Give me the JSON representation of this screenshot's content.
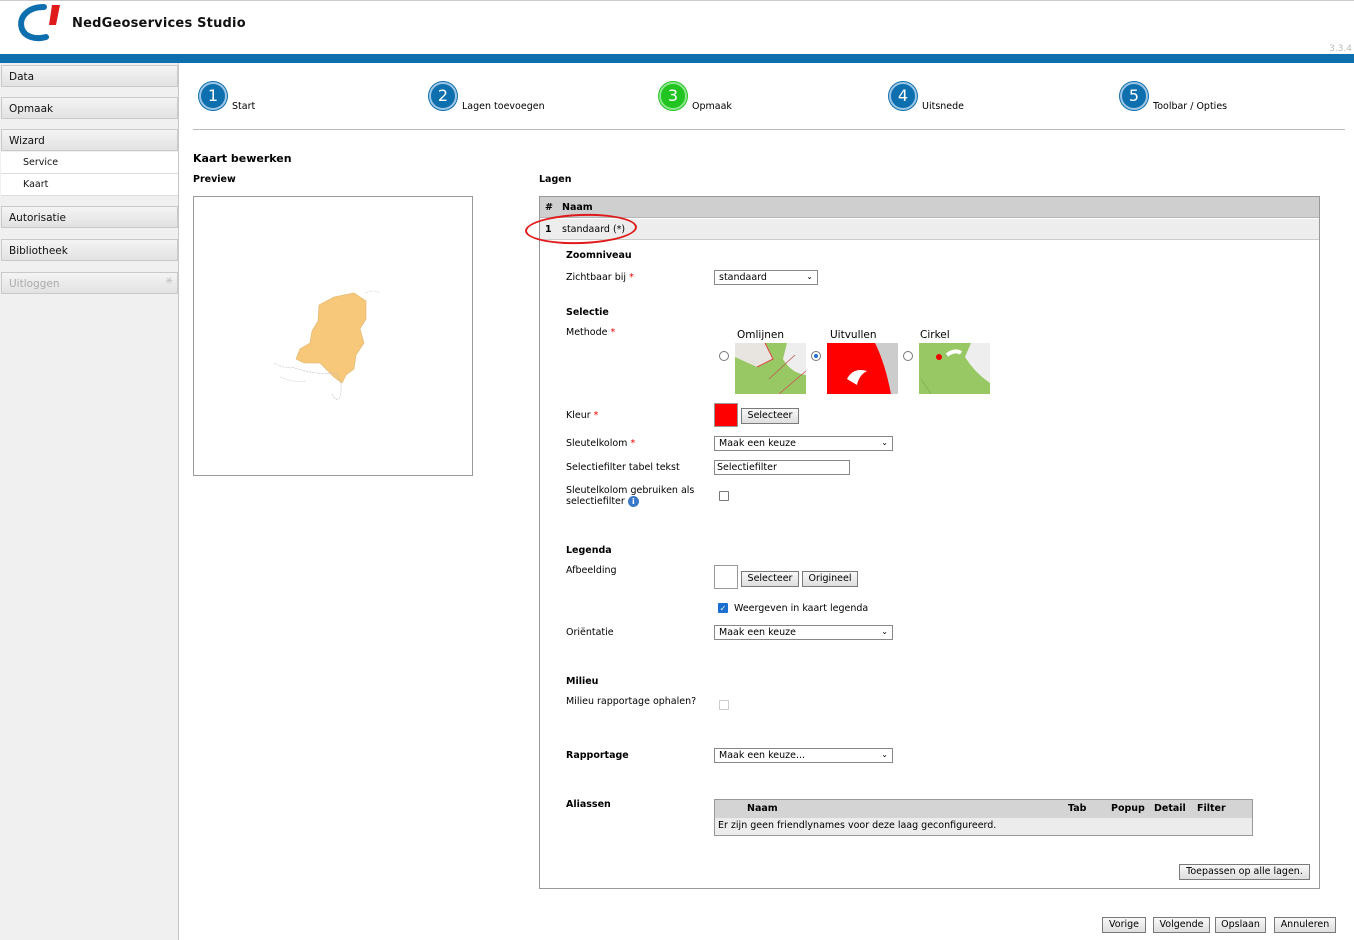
{
  "app": {
    "title": "NedGeoservices Studio",
    "version": "3.3.4"
  },
  "sidebar": {
    "items": [
      {
        "label": "Data"
      },
      {
        "label": "Opmaak"
      },
      {
        "label": "Wizard"
      },
      {
        "label": "Autorisatie"
      },
      {
        "label": "Bibliotheek"
      },
      {
        "label": "Uitloggen"
      }
    ],
    "wizard_sub": [
      {
        "label": "Service"
      },
      {
        "label": "Kaart"
      }
    ]
  },
  "wizard": {
    "steps": [
      {
        "num": "1",
        "label": "Start"
      },
      {
        "num": "2",
        "label": "Lagen toevoegen"
      },
      {
        "num": "3",
        "label": "Opmaak",
        "active": true
      },
      {
        "num": "4",
        "label": "Uitsnede"
      },
      {
        "num": "5",
        "label": "Toolbar / Opties"
      }
    ]
  },
  "page": {
    "title": "Kaart bewerken",
    "preview_label": "Preview",
    "lagen_label": "Lagen"
  },
  "lagen": {
    "col_num": "#",
    "col_name": "Naam",
    "row": {
      "num": "1",
      "name": "standaard (*)"
    }
  },
  "form": {
    "zoom": {
      "heading": "Zoomniveau",
      "label": "Zichtbaar bij",
      "required": "*",
      "value": "standaard"
    },
    "selectie": {
      "heading": "Selectie",
      "method_label": "Methode",
      "required": "*",
      "options": [
        "Omlijnen",
        "Uitvullen",
        "Cirkel"
      ],
      "selected_option": "Uitvullen",
      "kleur_label": "Kleur",
      "kleur_color": "#ff0000",
      "kleur_button": "Selecteer",
      "sleutel_label": "Sleutelkolom",
      "sleutel_value": "Maak een keuze",
      "filter_label": "Selectiefilter tabel tekst",
      "filter_value": "Selectiefilter",
      "use_as_filter_label_1": "Sleutelkolom gebruiken als",
      "use_as_filter_label_2": "selectiefilter",
      "use_as_filter_checked": false
    },
    "legenda": {
      "heading": "Legenda",
      "afbeelding_label": "Afbeelding",
      "select_button": "Selecteer",
      "original_button": "Origineel",
      "show_label": "Weergeven in kaart legenda",
      "show_checked": true,
      "orientatie_label": "Oriëntatie",
      "orientatie_value": "Maak een keuze"
    },
    "milieu": {
      "heading": "Milieu",
      "label": "Milieu rapportage ophalen?",
      "checked": false
    },
    "rapportage": {
      "heading": "Rapportage",
      "value": "Maak een keuze..."
    },
    "aliassen": {
      "heading": "Aliassen",
      "columns": [
        "Naam",
        "Tab",
        "Popup",
        "Detail",
        "Filter"
      ],
      "empty_text": "Er zijn geen friendlynames voor deze laag geconfigureerd."
    },
    "apply_all_button": "Toepassen op alle lagen."
  },
  "footer": {
    "prev": "Vorige",
    "next": "Volgende",
    "save": "Opslaan",
    "cancel": "Annuleren"
  },
  "colors": {
    "brand_blue": "#0e6fae",
    "step_active": "#22c422",
    "map_fill": "#f7c77a"
  }
}
